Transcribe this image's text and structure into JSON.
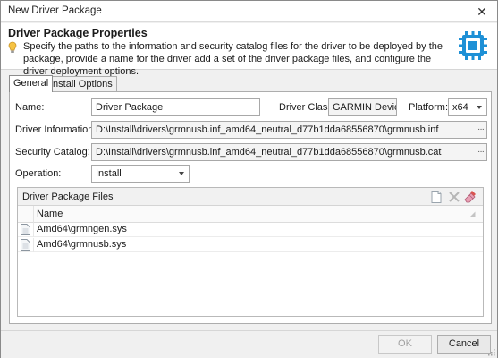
{
  "window": {
    "title": "New Driver Package",
    "close_glyph": "✕"
  },
  "header": {
    "title": "Driver Package Properties",
    "description": "Specify the paths to the information and security catalog files for the driver to be deployed by the package, provide a name for the driver add a set of the driver package files, and configure the driver deployment options.",
    "icons": {
      "hint": "lightbulb-icon",
      "package": "chip-icon"
    }
  },
  "tabs": [
    {
      "label": "General",
      "active": true
    },
    {
      "label": "Install Options",
      "active": false
    }
  ],
  "form": {
    "name_label": "Name:",
    "name_value": "Driver Package",
    "driver_class_label": "Driver Class:",
    "driver_class_value": "GARMIN Devices",
    "platform_label": "Platform:",
    "platform_value": "x64",
    "driver_info_label": "Driver Information:",
    "driver_info_value": "D:\\Install\\drivers\\grmnusb.inf_amd64_neutral_d77b1dda68556870\\grmnusb.inf",
    "security_catalog_label": "Security Catalog:",
    "security_catalog_value": "D:\\Install\\drivers\\grmnusb.inf_amd64_neutral_d77b1dda68556870\\grmnusb.cat",
    "operation_label": "Operation:",
    "operation_value": "Install",
    "browse_glyph": "···"
  },
  "files": {
    "title": "Driver Package Files",
    "column_name": "Name",
    "rows": [
      {
        "name": "Amd64\\grmngen.sys",
        "icon": "file-icon"
      },
      {
        "name": "Amd64\\grmnusb.sys",
        "icon": "file-icon"
      }
    ],
    "tools": [
      "new-file-icon",
      "delete-icon",
      "eraser-icon"
    ]
  },
  "footer": {
    "ok_label": "OK",
    "cancel_label": "Cancel",
    "ok_enabled": false
  },
  "colors": {
    "accent": "#1e90d6",
    "header_bg": "#ffffff",
    "window_bg": "#f0f0f0",
    "delete": "#c0392b"
  }
}
